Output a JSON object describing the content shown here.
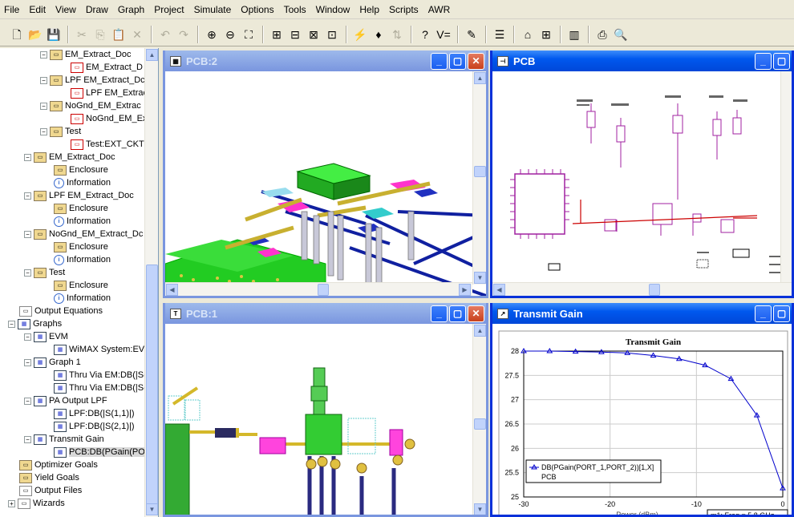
{
  "menubar": [
    "File",
    "Edit",
    "View",
    "Draw",
    "Graph",
    "Project",
    "Simulate",
    "Options",
    "Tools",
    "Window",
    "Help",
    "Scripts",
    "AWR"
  ],
  "toolbar": {
    "buttons": [
      {
        "name": "new-icon",
        "glyph": "🗋",
        "disabled": false
      },
      {
        "name": "open-icon",
        "glyph": "📂",
        "disabled": false
      },
      {
        "name": "save-icon",
        "glyph": "💾",
        "disabled": false
      },
      {
        "sep": true
      },
      {
        "name": "cut-icon",
        "glyph": "✂",
        "disabled": true
      },
      {
        "name": "copy-icon",
        "glyph": "⎘",
        "disabled": true
      },
      {
        "name": "paste-icon",
        "glyph": "📋",
        "disabled": true
      },
      {
        "name": "delete-icon",
        "glyph": "✕",
        "disabled": true
      },
      {
        "sep": true
      },
      {
        "name": "undo-icon",
        "glyph": "↶",
        "disabled": true
      },
      {
        "name": "redo-icon",
        "glyph": "↷",
        "disabled": true
      },
      {
        "sep": true
      },
      {
        "name": "zoom-in-icon",
        "glyph": "⊕",
        "disabled": false
      },
      {
        "name": "zoom-out-icon",
        "glyph": "⊖",
        "disabled": false
      },
      {
        "name": "zoom-fit-icon",
        "glyph": "⛶",
        "disabled": false
      },
      {
        "sep": true
      },
      {
        "name": "add-element-icon",
        "glyph": "⊞",
        "disabled": false
      },
      {
        "name": "add-port-icon",
        "glyph": "⊟",
        "disabled": false
      },
      {
        "name": "add-subcircuit-icon",
        "glyph": "⊠",
        "disabled": false
      },
      {
        "name": "add-wire-icon",
        "glyph": "⊡",
        "disabled": false
      },
      {
        "sep": true
      },
      {
        "name": "simulate-icon",
        "glyph": "⚡",
        "disabled": false
      },
      {
        "name": "tune-icon",
        "glyph": "♦",
        "disabled": false
      },
      {
        "name": "tune-bar-icon",
        "glyph": "⇅",
        "disabled": true
      },
      {
        "sep": true
      },
      {
        "name": "help-icon",
        "glyph": "?",
        "disabled": false
      },
      {
        "name": "variable-icon",
        "glyph": "V=",
        "disabled": false
      },
      {
        "sep": true
      },
      {
        "name": "edit-icon",
        "glyph": "✎",
        "disabled": false
      },
      {
        "sep": true
      },
      {
        "name": "properties-icon",
        "glyph": "☰",
        "disabled": false
      },
      {
        "sep": true
      },
      {
        "name": "layout-icon",
        "glyph": "⌂",
        "disabled": false
      },
      {
        "name": "layout-view-icon",
        "glyph": "⊞",
        "disabled": false
      },
      {
        "sep": true
      },
      {
        "name": "3d-view-icon",
        "glyph": "▥",
        "disabled": false
      },
      {
        "sep": true
      },
      {
        "name": "print-icon",
        "glyph": "⎙",
        "disabled": false
      },
      {
        "name": "print-preview-icon",
        "glyph": "🔍",
        "disabled": false
      }
    ]
  },
  "tree": {
    "items": [
      {
        "indent": 50,
        "exp": "−",
        "icon": "doc",
        "label": "EM_Extract_Doc"
      },
      {
        "indent": 88,
        "exp": "",
        "icon": "sch",
        "label": "EM_Extract_D"
      },
      {
        "indent": 50,
        "exp": "−",
        "icon": "doc",
        "label": "LPF EM_Extract_Dc"
      },
      {
        "indent": 88,
        "exp": "",
        "icon": "sch",
        "label": "LPF EM_Extrac"
      },
      {
        "indent": 50,
        "exp": "−",
        "icon": "doc",
        "label": "NoGnd_EM_Extrac"
      },
      {
        "indent": 88,
        "exp": "",
        "icon": "sch",
        "label": "NoGnd_EM_Ex"
      },
      {
        "indent": 50,
        "exp": "−",
        "icon": "doc",
        "label": "Test"
      },
      {
        "indent": 88,
        "exp": "",
        "icon": "sch",
        "label": "Test:EXT_CKT"
      },
      {
        "indent": 30,
        "exp": "−",
        "icon": "doc",
        "label": "EM_Extract_Doc"
      },
      {
        "indent": 67,
        "exp": "",
        "icon": "doc",
        "label": "Enclosure"
      },
      {
        "indent": 67,
        "exp": "",
        "icon": "info",
        "label": "Information"
      },
      {
        "indent": 30,
        "exp": "−",
        "icon": "doc",
        "label": "LPF EM_Extract_Doc"
      },
      {
        "indent": 67,
        "exp": "",
        "icon": "doc",
        "label": "Enclosure"
      },
      {
        "indent": 67,
        "exp": "",
        "icon": "info",
        "label": "Information"
      },
      {
        "indent": 30,
        "exp": "−",
        "icon": "doc",
        "label": "NoGnd_EM_Extract_Dc"
      },
      {
        "indent": 67,
        "exp": "",
        "icon": "doc",
        "label": "Enclosure"
      },
      {
        "indent": 67,
        "exp": "",
        "icon": "info",
        "label": "Information"
      },
      {
        "indent": 30,
        "exp": "−",
        "icon": "doc",
        "label": "Test"
      },
      {
        "indent": 67,
        "exp": "",
        "icon": "doc",
        "label": "Enclosure"
      },
      {
        "indent": 67,
        "exp": "",
        "icon": "info",
        "label": "Information"
      },
      {
        "indent": 24,
        "exp": "",
        "icon": "plain",
        "label": "Output Equations"
      },
      {
        "indent": 10,
        "exp": "−",
        "icon": "graph",
        "label": "Graphs"
      },
      {
        "indent": 30,
        "exp": "−",
        "icon": "graph",
        "label": "EVM"
      },
      {
        "indent": 67,
        "exp": "",
        "icon": "graph",
        "label": "WiMAX System:EVI"
      },
      {
        "indent": 30,
        "exp": "−",
        "icon": "graph",
        "label": "Graph 1"
      },
      {
        "indent": 67,
        "exp": "",
        "icon": "graph",
        "label": "Thru Via EM:DB(|S("
      },
      {
        "indent": 67,
        "exp": "",
        "icon": "graph",
        "label": "Thru Via EM:DB(|S("
      },
      {
        "indent": 30,
        "exp": "−",
        "icon": "graph",
        "label": "PA Output LPF"
      },
      {
        "indent": 67,
        "exp": "",
        "icon": "graph",
        "label": "LPF:DB(|S(1,1)|)"
      },
      {
        "indent": 67,
        "exp": "",
        "icon": "graph",
        "label": "LPF:DB(|S(2,1)|)"
      },
      {
        "indent": 30,
        "exp": "−",
        "icon": "graph",
        "label": "Transmit Gain"
      },
      {
        "indent": 67,
        "exp": "",
        "icon": "graph",
        "label": "PCB:DB(PGain(POR",
        "selected": true
      },
      {
        "indent": 24,
        "exp": "",
        "icon": "doc",
        "label": "Optimizer Goals"
      },
      {
        "indent": 24,
        "exp": "",
        "icon": "doc",
        "label": "Yield Goals"
      },
      {
        "indent": 24,
        "exp": "",
        "icon": "plain",
        "label": "Output Files"
      },
      {
        "indent": 10,
        "exp": "+",
        "icon": "plain",
        "label": "Wizards"
      }
    ]
  },
  "windows": {
    "pcb2": {
      "title": "PCB:2"
    },
    "pcb": {
      "title": "PCB"
    },
    "pcb1": {
      "title": "PCB:1"
    },
    "gain": {
      "title": "Transmit Gain"
    }
  },
  "chart_data": {
    "type": "line",
    "title": "Transmit Gain",
    "xlabel": "Power (dBm)",
    "ylabel": "",
    "xlim": [
      -30,
      0
    ],
    "ylim": [
      25,
      28
    ],
    "xticks": [
      -30,
      -20,
      -10,
      0
    ],
    "yticks": [
      25,
      25.5,
      26,
      26.5,
      27,
      27.5,
      28
    ],
    "grid": true,
    "legend_position": "bottom-left",
    "series": [
      {
        "name": "DB(PGain(PORT_1,PORT_2))[1,X]",
        "source": "PCB",
        "color": "#0000cc",
        "x": [
          -30,
          -27,
          -24,
          -21,
          -18,
          -15,
          -12,
          -9,
          -6,
          -3,
          0
        ],
        "y": [
          28.0,
          28.0,
          27.99,
          27.98,
          27.96,
          27.91,
          27.84,
          27.71,
          27.43,
          26.68,
          25.18
        ]
      }
    ],
    "marker_label": "m1: Freq = 5.8 GHz"
  }
}
